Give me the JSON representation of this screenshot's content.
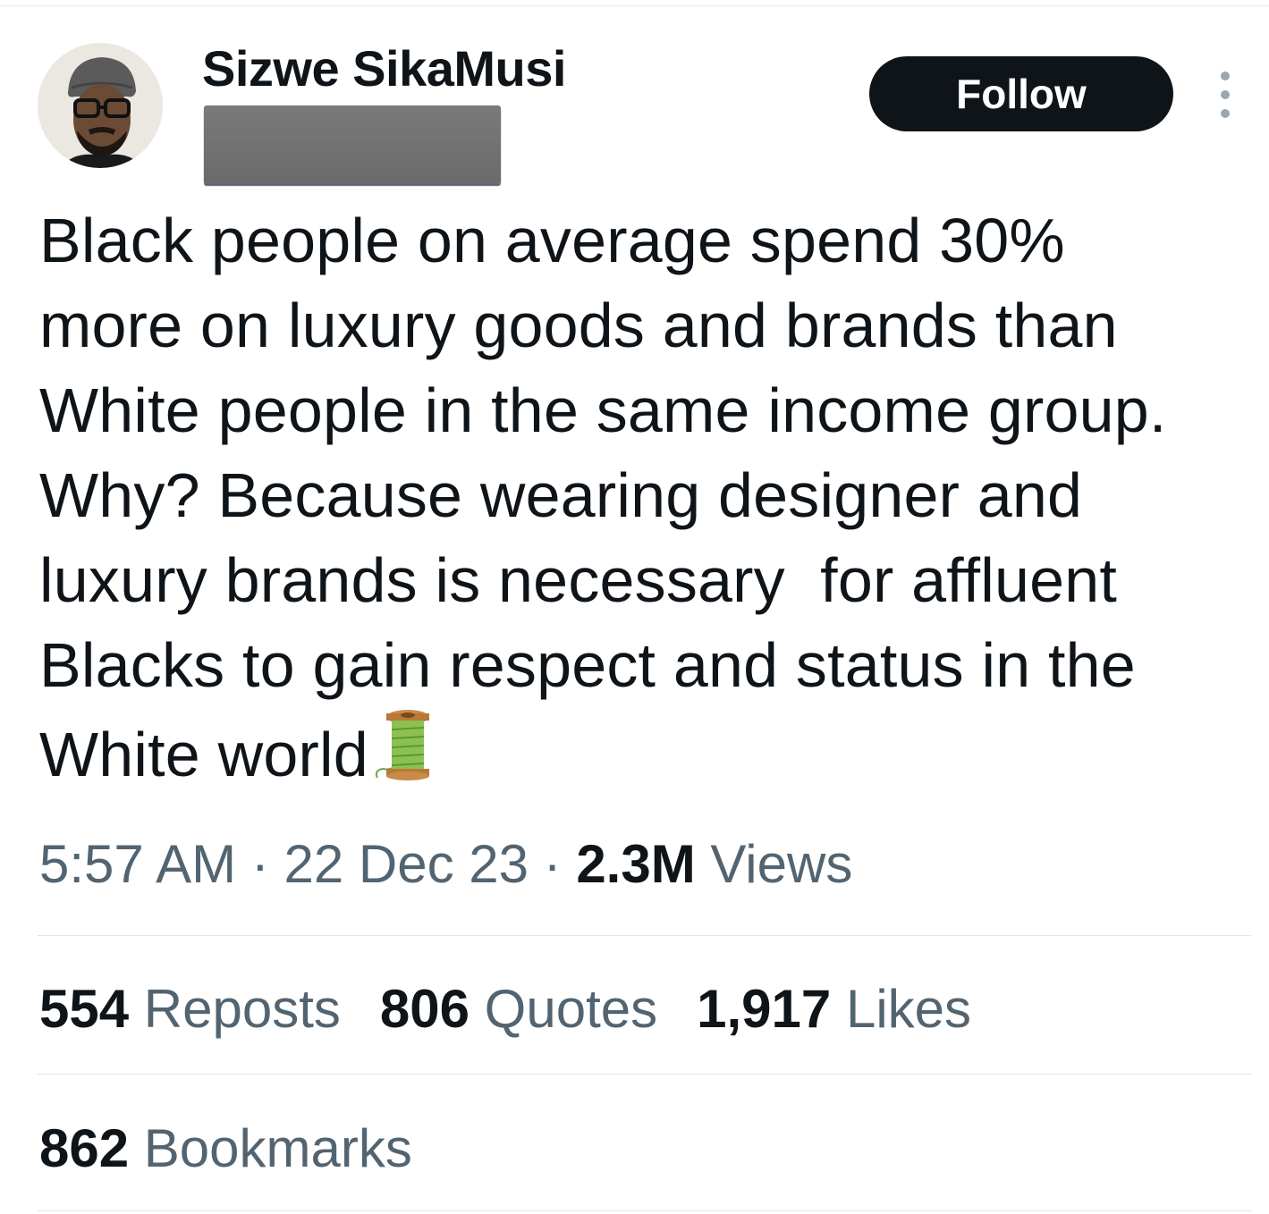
{
  "author": {
    "display_name": "Sizwe SikaMusi"
  },
  "follow_button": {
    "label": "Follow"
  },
  "more_button": {
    "icon": "more-vertical-icon"
  },
  "tweet": {
    "text_lines": [
      "Black people on average spend 30%",
      "more on luxury goods and brands than",
      "White people in the same income group.",
      "Why? Because wearing designer and",
      "luxury brands is necessary  for affluent",
      "Blacks to gain respect and status in the",
      "White world"
    ],
    "emoji": "spool-of-thread-icon"
  },
  "meta": {
    "time": "5:57 AM",
    "separator": "·",
    "date": "22 Dec 23",
    "views_count": "2.3M",
    "views_label": "Views"
  },
  "stats": {
    "reposts_count": "554",
    "reposts_label": "Reposts",
    "quotes_count": "806",
    "quotes_label": "Quotes",
    "likes_count": "1,917",
    "likes_label": "Likes",
    "bookmarks_count": "862",
    "bookmarks_label": "Bookmarks"
  },
  "colors": {
    "text_primary": "#0f1419",
    "text_secondary": "#536471",
    "button_bg": "#0f1419",
    "button_text": "#ffffff",
    "divider": "#dfe5ea",
    "redaction": "#707070"
  }
}
